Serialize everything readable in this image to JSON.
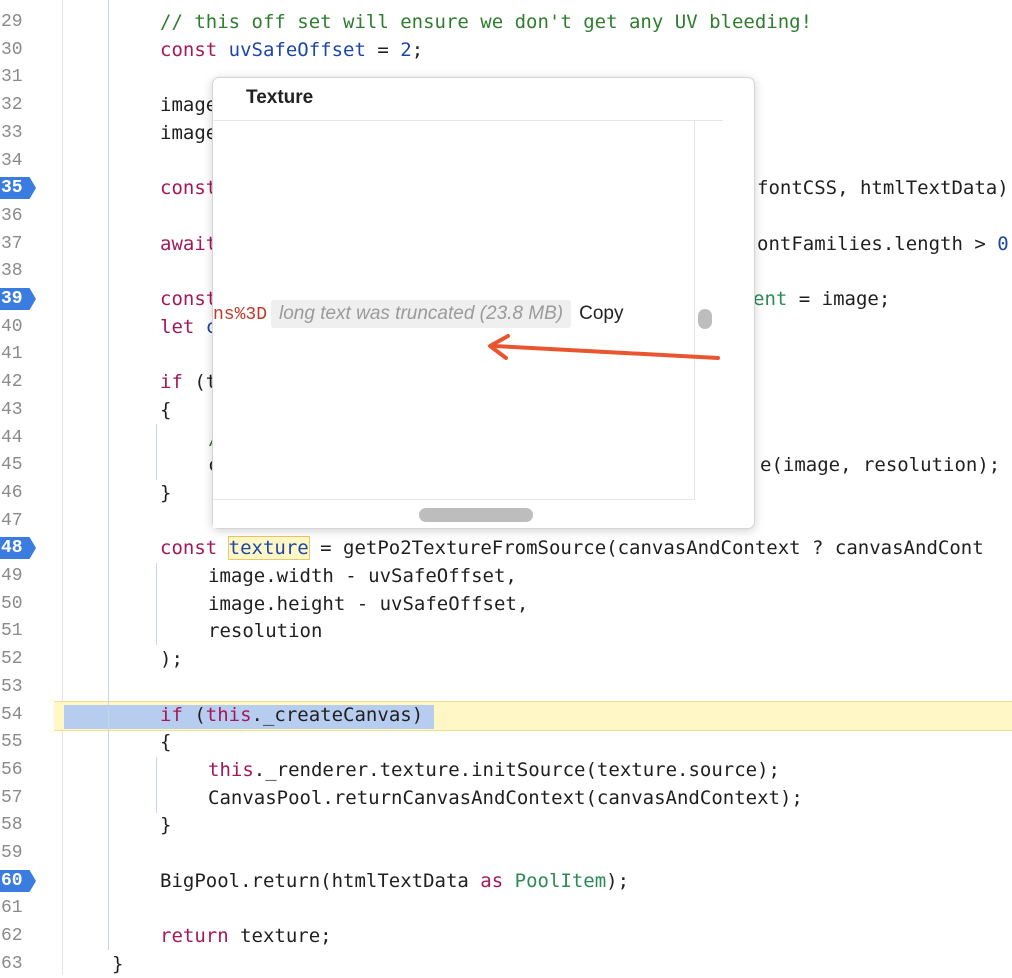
{
  "editor": {
    "lines": [
      {
        "n": "29",
        "bp": false
      },
      {
        "n": "30",
        "bp": false
      },
      {
        "n": "31",
        "bp": false
      },
      {
        "n": "32",
        "bp": false
      },
      {
        "n": "33",
        "bp": false
      },
      {
        "n": "34",
        "bp": false
      },
      {
        "n": "35",
        "bp": true
      },
      {
        "n": "36",
        "bp": false
      },
      {
        "n": "37",
        "bp": false
      },
      {
        "n": "38",
        "bp": false
      },
      {
        "n": "39",
        "bp": true
      },
      {
        "n": "40",
        "bp": false
      },
      {
        "n": "41",
        "bp": false
      },
      {
        "n": "42",
        "bp": false
      },
      {
        "n": "43",
        "bp": false
      },
      {
        "n": "44",
        "bp": false
      },
      {
        "n": "45",
        "bp": false
      },
      {
        "n": "46",
        "bp": false
      },
      {
        "n": "47",
        "bp": false
      },
      {
        "n": "48",
        "bp": true
      },
      {
        "n": "49",
        "bp": false
      },
      {
        "n": "50",
        "bp": false
      },
      {
        "n": "51",
        "bp": false
      },
      {
        "n": "52",
        "bp": false
      },
      {
        "n": "53",
        "bp": false
      },
      {
        "n": "54",
        "bp": false
      },
      {
        "n": "55",
        "bp": false
      },
      {
        "n": "56",
        "bp": false
      },
      {
        "n": "57",
        "bp": false
      },
      {
        "n": "58",
        "bp": false
      },
      {
        "n": "59",
        "bp": false
      },
      {
        "n": "60",
        "bp": true
      },
      {
        "n": "61",
        "bp": false
      },
      {
        "n": "62",
        "bp": false
      },
      {
        "n": "63",
        "bp": false
      }
    ],
    "code": {
      "l29": "// this off set will ensure we don't get any UV bleeding!",
      "l30_kw": "const",
      "l30_var": "uvSafeOffset",
      "l30_rest": " = ",
      "l30_num": "2",
      "l30_end": ";",
      "l32": "image",
      "l33": "image",
      "l35_kw": "const",
      "l35_tail": "fontCSS, htmlTextData)",
      "l37_kw": "await",
      "l37_tail": "ontFamilies.length > ",
      "l37_num": "0",
      "l39_kw": "const",
      "l39_tail_var": "ent",
      "l39_tail": " = image;",
      "l40_kw": "let",
      "l40_rest": "c",
      "l42_kw": "if",
      "l42_rest": " (t",
      "l43": "{",
      "l44": "/",
      "l45_head": "c",
      "l45_tail": "e(image, resolution);",
      "l46": "}",
      "l48_kw": "const",
      "l48_var": "texture",
      "l48_rest": " = getPo2TextureFromSource(canvasAndContext ? canvasAndCont",
      "l49": "image.width - uvSafeOffset,",
      "l50": "image.height - uvSafeOffset,",
      "l51": "resolution",
      "l52": ");",
      "l54_kw": "if",
      "l54_rest1": " (",
      "l54_this": "this",
      "l54_rest2": "._createCanvas)",
      "l55": "{",
      "l56_this": "this",
      "l56_rest": "._renderer.texture.initSource(texture.source);",
      "l57": "CanvasPool.returnCanvasAndContext(canvasAndContext);",
      "l58": "}",
      "l60_a": "BigPool.return(htmlTextData ",
      "l60_kw": "as",
      "l60_sp": " ",
      "l60_type": "PoolItem",
      "l60_end": ");",
      "l62_kw": "return",
      "l62_rest": " texture;",
      "l63": "}"
    }
  },
  "popover": {
    "title": "Texture",
    "value_prefix": "ns%3D",
    "truncated_label": "long text was truncated (23.8 MB)",
    "copy_label": "Copy"
  },
  "colors": {
    "breakpoint": "#3b7ce0",
    "execution_line": "#fff8c6",
    "arrow": "#e8552f"
  }
}
